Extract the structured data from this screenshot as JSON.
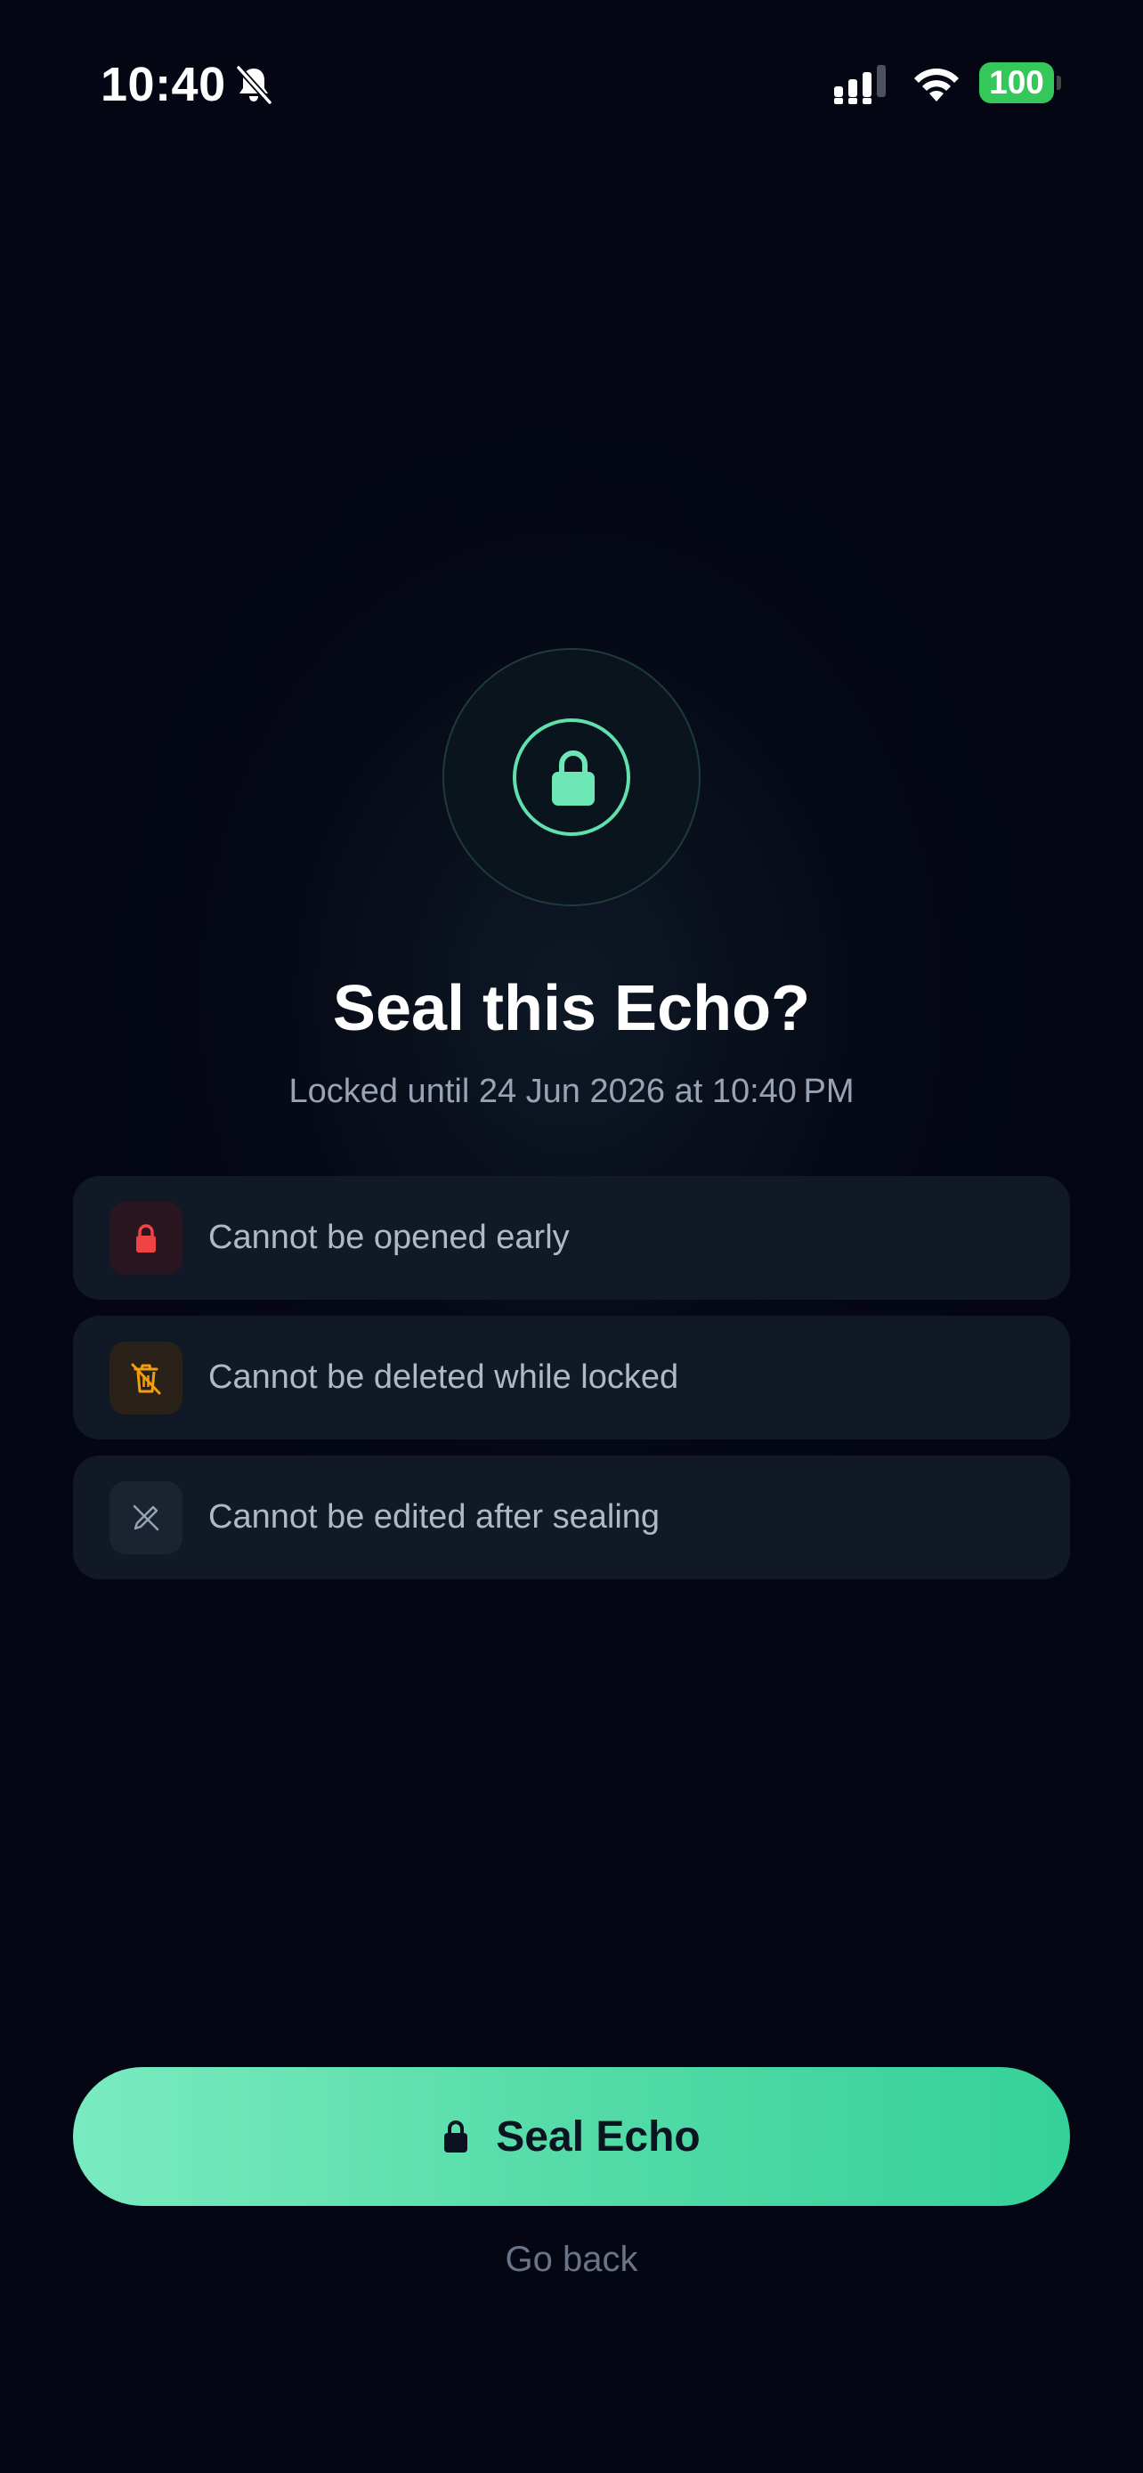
{
  "status_bar": {
    "time": "10:40",
    "battery_level": "100",
    "colors": {
      "battery": "#34c759"
    },
    "icons": [
      "bell-slash-icon",
      "cellular-signal-icon",
      "wifi-icon",
      "battery-icon"
    ]
  },
  "emblem": {
    "icon": "lock-icon",
    "accent_color": "#5fe0ac"
  },
  "dialog": {
    "title": "Seal this Echo?",
    "subtitle": "Locked until 24 Jun 2026 at 10:40 PM"
  },
  "warnings": [
    {
      "label": "Cannot be opened early",
      "icon": "lock-icon",
      "color": "#ef4444"
    },
    {
      "label": "Cannot be deleted while locked",
      "icon": "trash-slash-icon",
      "color": "#f59e0b"
    },
    {
      "label": "Cannot be edited after sealing",
      "icon": "edit-slash-icon",
      "color": "#94a3b8"
    }
  ],
  "actions": {
    "primary_label": "Seal Echo",
    "primary_icon": "lock-icon",
    "secondary_label": "Go back",
    "primary_gradient": [
      "#79ebc0",
      "#34d199"
    ]
  }
}
